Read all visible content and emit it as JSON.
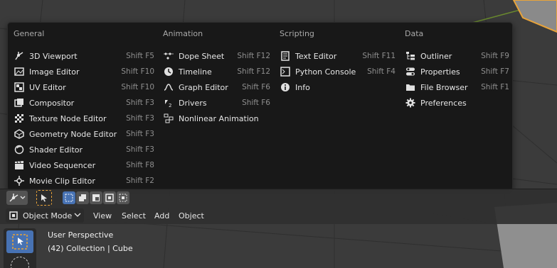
{
  "menu": {
    "columns": [
      {
        "heading": "General",
        "items": [
          {
            "label": "3D Viewport",
            "shortcut": "Shift F5",
            "icon": "viewport-3d-icon"
          },
          {
            "label": "Image Editor",
            "shortcut": "Shift F10",
            "icon": "image-icon"
          },
          {
            "label": "UV Editor",
            "shortcut": "Shift F10",
            "icon": "uv-icon"
          },
          {
            "label": "Compositor",
            "shortcut": "Shift F3",
            "icon": "compositor-icon"
          },
          {
            "label": "Texture Node Editor",
            "shortcut": "Shift F3",
            "icon": "texture-icon"
          },
          {
            "label": "Geometry Node Editor",
            "shortcut": "Shift F3",
            "icon": "geometry-nodes-icon"
          },
          {
            "label": "Shader Editor",
            "shortcut": "Shift F3",
            "icon": "shader-icon"
          },
          {
            "label": "Video Sequencer",
            "shortcut": "Shift F8",
            "icon": "sequencer-icon"
          },
          {
            "label": "Movie Clip Editor",
            "shortcut": "Shift F2",
            "icon": "clip-icon"
          }
        ]
      },
      {
        "heading": "Animation",
        "items": [
          {
            "label": "Dope Sheet",
            "shortcut": "Shift F12",
            "icon": "dopesheet-icon"
          },
          {
            "label": "Timeline",
            "shortcut": "Shift F12",
            "icon": "timeline-icon"
          },
          {
            "label": "Graph Editor",
            "shortcut": "Shift F6",
            "icon": "graph-icon"
          },
          {
            "label": "Drivers",
            "shortcut": "Shift F6",
            "icon": "drivers-icon"
          },
          {
            "label": "Nonlinear Animation",
            "shortcut": "",
            "icon": "nla-icon"
          }
        ]
      },
      {
        "heading": "Scripting",
        "items": [
          {
            "label": "Text Editor",
            "shortcut": "Shift F11",
            "icon": "text-icon"
          },
          {
            "label": "Python Console",
            "shortcut": "Shift F4",
            "icon": "console-icon"
          },
          {
            "label": "Info",
            "shortcut": "",
            "icon": "info-icon"
          }
        ]
      },
      {
        "heading": "Data",
        "items": [
          {
            "label": "Outliner",
            "shortcut": "Shift F9",
            "icon": "outliner-icon"
          },
          {
            "label": "Properties",
            "shortcut": "Shift F7",
            "icon": "properties-icon"
          },
          {
            "label": "File Browser",
            "shortcut": "Shift F1",
            "icon": "folder-icon"
          },
          {
            "label": "Preferences",
            "shortcut": "",
            "icon": "gear-icon"
          }
        ]
      }
    ]
  },
  "header": {
    "mode": "Object Mode",
    "menus": [
      "View",
      "Select",
      "Add",
      "Object"
    ]
  },
  "viewport_info": {
    "perspective": "User Perspective",
    "collection": "(42) Collection | Cube"
  },
  "colors": {
    "menu_bg": "#181818",
    "accent": "#4772b3",
    "selection_outline": "#e8a33a"
  }
}
